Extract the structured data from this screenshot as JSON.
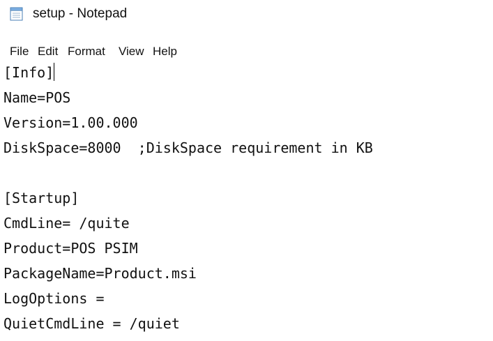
{
  "window": {
    "title": "setup - Notepad",
    "app_icon": "notepad-icon"
  },
  "menu": {
    "file": "File",
    "edit": "Edit",
    "format": "Format",
    "view": "View",
    "help": "Help"
  },
  "editor": {
    "lines": [
      "[Info]",
      "Name=POS",
      "Version=1.00.000",
      "DiskSpace=8000  ;DiskSpace requirement in KB",
      "",
      "[Startup]",
      "CmdLine= /quite",
      "Product=POS PSIM",
      "PackageName=Product.msi",
      "LogOptions =",
      "QuietCmdLine = /quiet"
    ]
  }
}
